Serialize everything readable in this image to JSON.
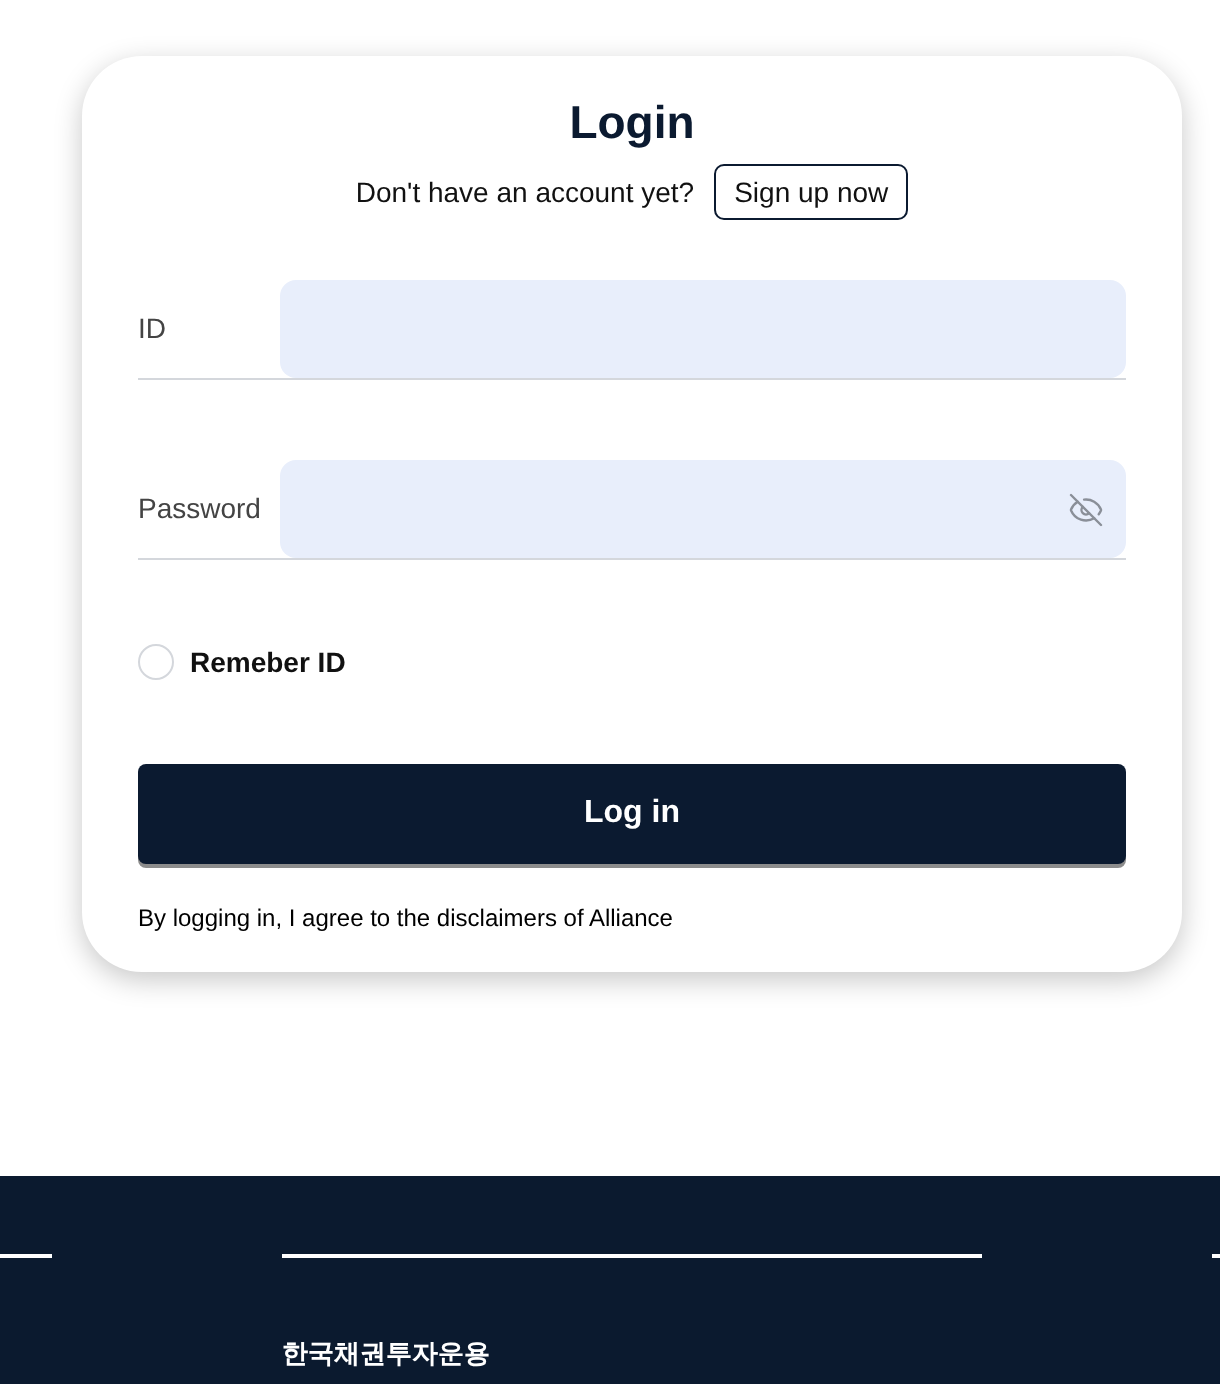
{
  "login": {
    "title": "Login",
    "signup_prompt": "Don't have an account yet?",
    "signup_button": "Sign up now",
    "fields": [
      {
        "label": "ID",
        "kind": "text"
      },
      {
        "label": "Password",
        "kind": "password"
      }
    ],
    "remember": {
      "label": "Remeber ID",
      "checked": false
    },
    "submit": "Log in",
    "disclaimer": "By logging in, I agree to the disclaimers of Alliance"
  },
  "footer": {
    "company": "한국채권투자운용"
  }
}
